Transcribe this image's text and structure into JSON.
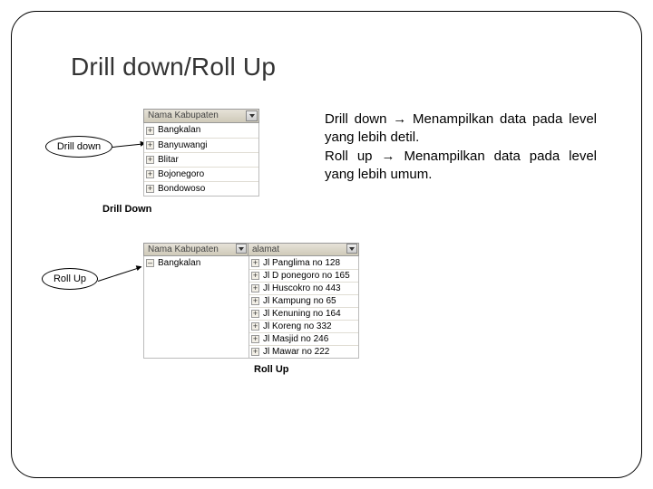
{
  "title": "Drill down/Roll Up",
  "body": {
    "line1": "Drill down → Menampilkan data pada level yang lebih detil.",
    "line2": "Roll up → Menampilkan data pada level yang lebih umum."
  },
  "callouts": {
    "drilldown": "Drill down",
    "rollup": "Roll Up"
  },
  "captions": {
    "drilldown": "Drill Down",
    "rollup": "Roll Up"
  },
  "icons": {
    "plus": "+",
    "minus": "–"
  },
  "table1": {
    "header": "Nama Kabupaten",
    "rows": [
      "Bangkalan",
      "Banyuwangi",
      "Blitar",
      "Bojonegoro",
      "Bondowoso"
    ]
  },
  "table2": {
    "headers": [
      "Nama Kabupaten",
      "alamat"
    ],
    "col1_row": "Bangkalan",
    "col2_rows": [
      "Jl Panglima no 128",
      "Jl D ponegoro no 165",
      "Jl Huscokro no 443",
      "Jl Kampung no 65",
      "Jl Kenuning no 164",
      "Jl Koreng no 332",
      "Jl Masjid no 246",
      "Jl Mawar no 222"
    ]
  }
}
